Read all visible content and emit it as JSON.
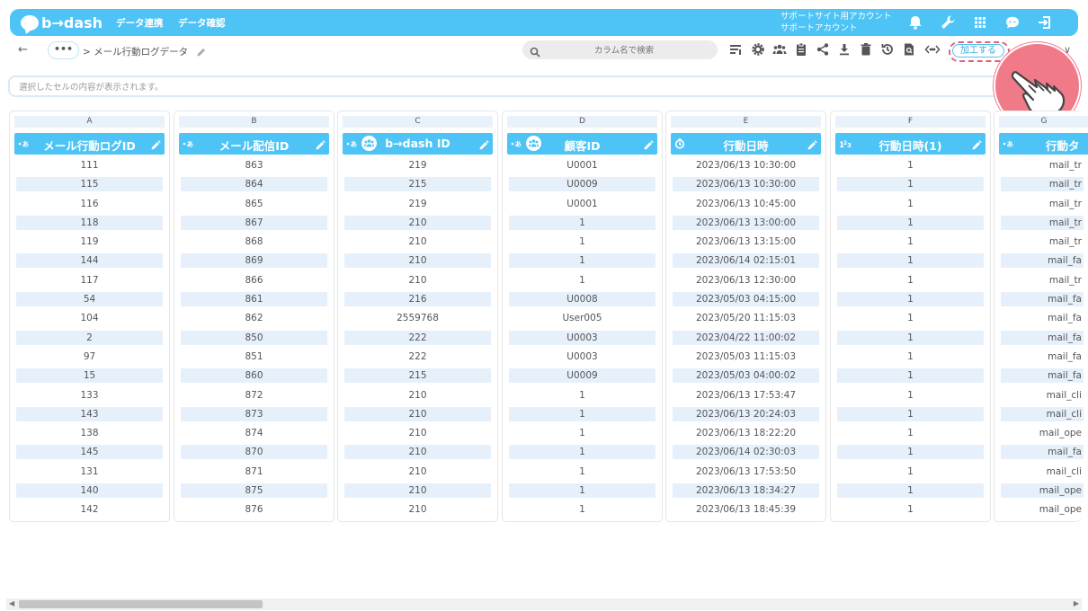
{
  "app": {
    "logo": "b→dash",
    "nav": [
      "データ連携",
      "データ確認"
    ],
    "account_line1": "サポートサイト用アカウント",
    "account_line2": "サポートアカウント"
  },
  "breadcrumb": {
    "back": "←",
    "more": "•••",
    "path": "> メール行動ログデータ"
  },
  "search": {
    "placeholder": "カラム名で検索"
  },
  "toolbar": {
    "process_label": "加工する",
    "chevron": "∨"
  },
  "cell_info": {
    "text": "選択したセルの内容が表示されます。"
  },
  "colors": {
    "accent": "#4dc4f5",
    "highlight": "#f07a88",
    "row_alt": "#e6f0fa"
  },
  "columns": [
    {
      "letter": "A",
      "name": "メール行動ログID",
      "type_icon": "text-type-icon",
      "rows": [
        "111",
        "115",
        "116",
        "118",
        "119",
        "144",
        "117",
        "54",
        "104",
        "2",
        "97",
        "15",
        "133",
        "143",
        "138",
        "145",
        "131",
        "140",
        "142"
      ]
    },
    {
      "letter": "B",
      "name": "メール配信ID",
      "type_icon": "text-type-icon",
      "rows": [
        "863",
        "864",
        "865",
        "867",
        "868",
        "869",
        "866",
        "861",
        "862",
        "850",
        "851",
        "860",
        "872",
        "873",
        "874",
        "870",
        "871",
        "875",
        "876"
      ]
    },
    {
      "letter": "C",
      "name": "b→dash ID",
      "type_icon": "text-type-icon",
      "people_icon": true,
      "rows": [
        "219",
        "215",
        "219",
        "210",
        "210",
        "210",
        "210",
        "216",
        "2559768",
        "222",
        "222",
        "215",
        "210",
        "210",
        "210",
        "210",
        "210",
        "210",
        "210"
      ]
    },
    {
      "letter": "D",
      "name": "顧客ID",
      "type_icon": "text-type-icon",
      "people_icon": true,
      "rows": [
        "U0001",
        "U0009",
        "U0001",
        "1",
        "1",
        "1",
        "1",
        "U0008",
        "User005",
        "U0003",
        "U0003",
        "U0009",
        "1",
        "1",
        "1",
        "1",
        "1",
        "1",
        "1"
      ]
    },
    {
      "letter": "E",
      "name": "行動日時",
      "type_icon": "clock-type-icon",
      "rows": [
        "2023/06/13 10:30:00",
        "2023/06/13 10:30:00",
        "2023/06/13 10:45:00",
        "2023/06/13 13:00:00",
        "2023/06/13 13:15:00",
        "2023/06/14 02:15:01",
        "2023/06/13 12:30:00",
        "2023/05/03 04:15:00",
        "2023/05/20 11:15:03",
        "2023/04/22 11:00:02",
        "2023/05/03 11:15:03",
        "2023/05/03 04:00:02",
        "2023/06/13 17:53:47",
        "2023/06/13 20:24:03",
        "2023/06/13 18:22:20",
        "2023/06/14 02:30:03",
        "2023/06/13 17:53:50",
        "2023/06/13 18:34:27",
        "2023/06/13 18:45:39"
      ]
    },
    {
      "letter": "F",
      "name": "行動日時(1)",
      "type_icon": "number-type-icon",
      "rows": [
        "1",
        "1",
        "1",
        "1",
        "1",
        "1",
        "1",
        "1",
        "1",
        "1",
        "1",
        "1",
        "1",
        "1",
        "1",
        "1",
        "1",
        "1",
        "1"
      ]
    },
    {
      "letter": "G",
      "name": "行動タ",
      "type_icon": "text-type-icon",
      "rows": [
        "mail_tr",
        "mail_tr",
        "mail_tr",
        "mail_tr",
        "mail_tr",
        "mail_fa",
        "mail_tr",
        "mail_fa",
        "mail_fa",
        "mail_fa",
        "mail_fa",
        "mail_fa",
        "mail_cli",
        "mail_cli",
        "mail_ope",
        "mail_fa",
        "mail_cli",
        "mail_ope",
        "mail_ope"
      ]
    }
  ]
}
